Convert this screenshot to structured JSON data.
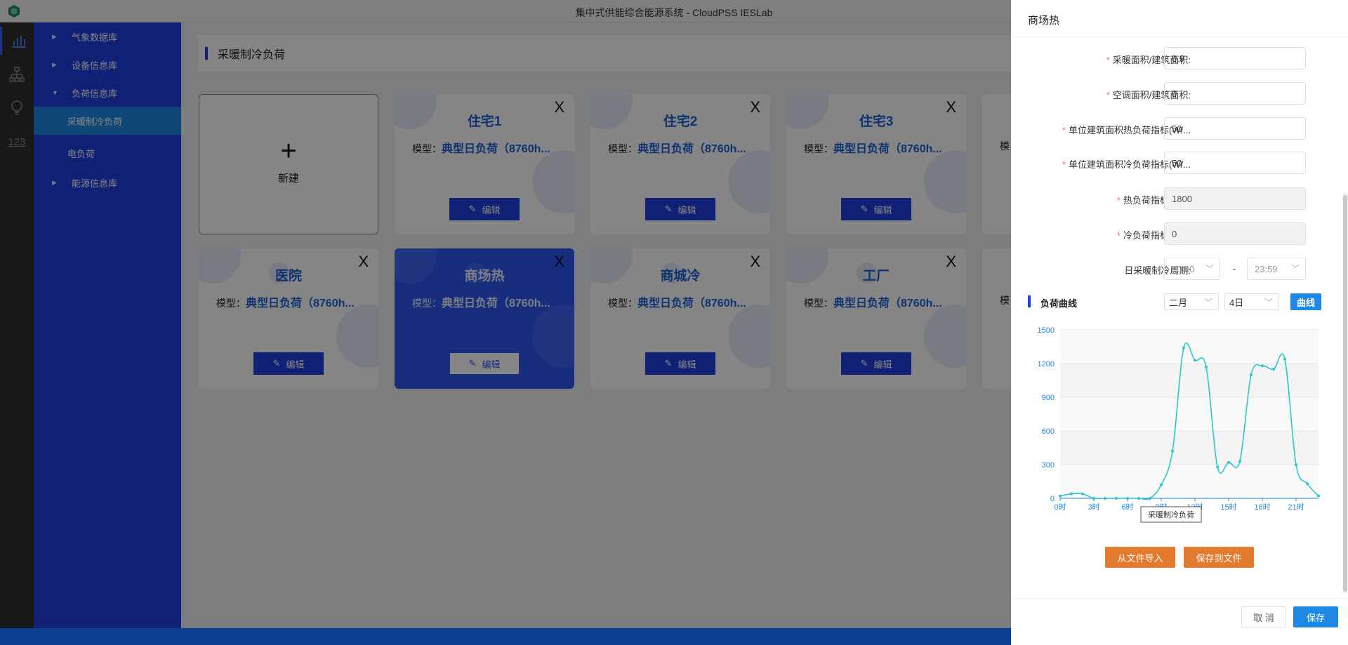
{
  "window": {
    "title": "集中式供能综合能源系统 - CloudPSS IESLab"
  },
  "iconbar": {
    "items": [
      "chart-bar-icon",
      "topology-icon",
      "bulb-icon",
      "number-123-icon"
    ],
    "number_label": "123"
  },
  "tree": {
    "items": [
      {
        "label": "气象数据库",
        "caret": "▶"
      },
      {
        "label": "设备信息库",
        "caret": "▶"
      },
      {
        "label": "负荷信息库",
        "caret": "▼"
      },
      {
        "label": "采暖制冷负荷"
      },
      {
        "label": "电负荷"
      },
      {
        "label": "能源信息库",
        "caret": "▶"
      }
    ]
  },
  "main": {
    "section_title": "采暖制冷负荷",
    "new_card": {
      "plus": "+",
      "label": "新建"
    },
    "cards": [
      {
        "name": "住宅1",
        "model_prefix": "模型：",
        "model": "典型日负荷（8760h...",
        "edit": "编辑",
        "close": "X"
      },
      {
        "name": "住宅2",
        "model_prefix": "模型：",
        "model": "典型日负荷（8760h...",
        "edit": "编辑",
        "close": "X"
      },
      {
        "name": "住宅3",
        "model_prefix": "模型：",
        "model": "典型日负荷（8760h...",
        "edit": "编辑",
        "close": "X"
      },
      {
        "name": "医院",
        "model_prefix": "模型：",
        "model": "典型日负荷（8760h...",
        "edit": "编辑",
        "close": "X"
      },
      {
        "name": "商场热",
        "model_prefix": "模型：",
        "model": "典型日负荷（8760h...",
        "edit": "编辑",
        "close": "X"
      },
      {
        "name": "商城冷",
        "model_prefix": "模型：",
        "model": "典型日负荷（8760h...",
        "edit": "编辑",
        "close": "X"
      },
      {
        "name": "工厂",
        "model_prefix": "模型：",
        "model": "典型日负荷（8760h...",
        "edit": "编辑",
        "close": "X"
      }
    ],
    "partial_card_label": "模"
  },
  "drawer": {
    "title": "商场热",
    "fields": [
      {
        "label": "采暖面积/建筑面积:",
        "value": "0.9",
        "required": "*"
      },
      {
        "label": "空调面积/建筑面积:",
        "value": "0",
        "required": "*"
      },
      {
        "label": "单位建筑面积热负荷指标(W/...",
        "value": "50",
        "required": "*"
      },
      {
        "label": "单位建筑面积冷负荷指标(W/...",
        "value": "50",
        "required": "*"
      },
      {
        "label": "热负荷指标(kW):",
        "value": "1800",
        "required": "*"
      },
      {
        "label": "冷负荷指标(kW):",
        "value": "0",
        "required": "*"
      }
    ],
    "period": {
      "label": "日采暖制冷周期:",
      "start": "00:00",
      "dash": "-",
      "end": "23:59"
    },
    "curve": {
      "title": "负荷曲线",
      "month": "二月",
      "day": "4日",
      "button": "曲线"
    },
    "import_label": "从文件导入",
    "export_label": "保存到文件",
    "cancel_label": "取 消",
    "save_label": "保存"
  },
  "colors": {
    "accent": "#1e3fe0",
    "line": "#2ec7c9",
    "orange": "#e37a2e",
    "primary": "#1e88e5"
  },
  "chart_data": {
    "type": "line",
    "x": [
      "0时",
      "1时",
      "2时",
      "3时",
      "4时",
      "5时",
      "6时",
      "7时",
      "8时",
      "9时",
      "10时",
      "11时",
      "12时",
      "13时",
      "14时",
      "15时",
      "16时",
      "17时",
      "18时",
      "19时",
      "20时",
      "21时",
      "22时",
      "23时"
    ],
    "x_tick_labels": [
      "0时",
      "3时",
      "6时",
      "9时",
      "12时",
      "15时",
      "18时",
      "21时"
    ],
    "series": [
      {
        "name": "采暖制冷负荷",
        "values": [
          20,
          40,
          40,
          0,
          0,
          0,
          0,
          0,
          0,
          120,
          420,
          1340,
          1230,
          1170,
          280,
          320,
          330,
          1100,
          1180,
          1150,
          1240,
          300,
          130,
          20
        ]
      }
    ],
    "ylim": [
      0,
      1500
    ],
    "y_ticks": [
      0,
      300,
      600,
      900,
      1200,
      1500
    ],
    "grid": true,
    "legend": "bottom-center"
  }
}
